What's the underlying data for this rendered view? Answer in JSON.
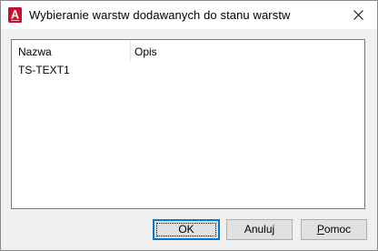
{
  "window": {
    "title": "Wybieranie warstw dodawanych do stanu warstw",
    "app_icon": "autocad-app-icon",
    "accent_color": "#c8102e",
    "close_icon": "close-icon"
  },
  "list": {
    "columns": [
      "Nazwa",
      "Opis"
    ],
    "rows": [
      {
        "name": "TS-TEXT1",
        "description": ""
      }
    ]
  },
  "buttons": {
    "ok": "OK",
    "cancel": "Anuluj",
    "help_first": "P",
    "help_rest": "omoc"
  }
}
